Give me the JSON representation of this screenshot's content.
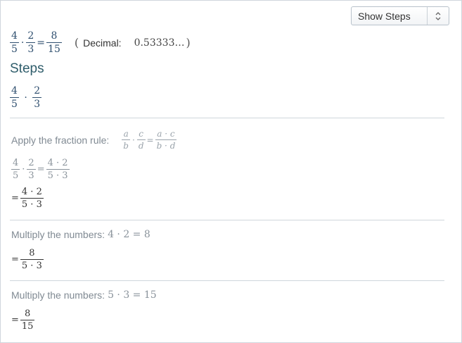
{
  "dropdown": {
    "selected": "Show Steps"
  },
  "result": {
    "lhs1": {
      "num": "4",
      "den": "5"
    },
    "lhs2": {
      "num": "2",
      "den": "3"
    },
    "rhs": {
      "num": "8",
      "den": "15"
    },
    "paren_open": "(",
    "decimal_label": "Decimal:",
    "decimal_value": "0.53333…",
    "paren_close": ")"
  },
  "steps_title": "Steps",
  "expression": {
    "a": {
      "num": "4",
      "den": "5"
    },
    "b": {
      "num": "2",
      "den": "3"
    }
  },
  "step1": {
    "label": "Apply the fraction rule:",
    "rule": {
      "a": "a",
      "b": "b",
      "c": "c",
      "d": "d",
      "num": "a · c",
      "den": "b · d"
    },
    "expr": {
      "a": {
        "num": "4",
        "den": "5"
      },
      "b": {
        "num": "2",
        "den": "3"
      },
      "r": {
        "num": "4 · 2",
        "den": "5 · 3"
      }
    },
    "result": {
      "num": "4 · 2",
      "den": "5 · 3"
    }
  },
  "step2": {
    "label": "Multiply the numbers:",
    "math": "4 · 2 = 8",
    "result": {
      "num": "8",
      "den": "5 · 3"
    }
  },
  "step3": {
    "label": "Multiply the numbers:",
    "math": "5 · 3 = 15",
    "result": {
      "num": "8",
      "den": "15"
    }
  },
  "symbols": {
    "dot": "·",
    "eq": "="
  }
}
